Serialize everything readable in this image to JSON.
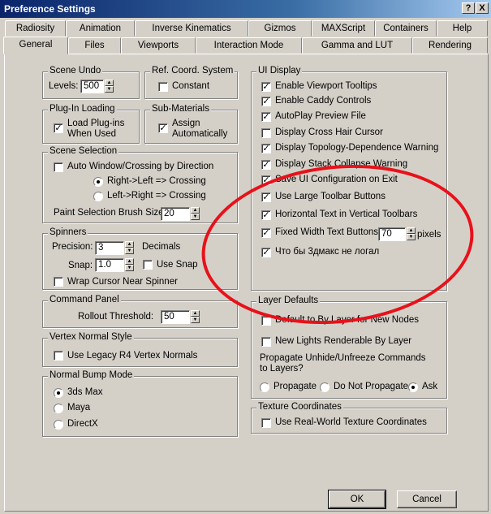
{
  "window": {
    "title": "Preference Settings",
    "help_btn": "?",
    "close_btn": "X"
  },
  "tabs_row1": [
    "Radiosity",
    "Animation",
    "Inverse Kinematics",
    "Gizmos",
    "MAXScript",
    "Containers",
    "Help"
  ],
  "tabs_row2": [
    "General",
    "Files",
    "Viewports",
    "Interaction Mode",
    "Gamma and LUT",
    "Rendering"
  ],
  "scene_undo": {
    "title": "Scene Undo",
    "levels_label": "Levels:",
    "levels_value": "500"
  },
  "ref_coord": {
    "title": "Ref. Coord. System",
    "constant_label": "Constant"
  },
  "plugin_loading": {
    "title": "Plug-In Loading",
    "load_label_1": "Load Plug-ins",
    "load_label_2": "When Used"
  },
  "sub_materials": {
    "title": "Sub-Materials",
    "assign_label_1": "Assign",
    "assign_label_2": "Automatically"
  },
  "scene_selection": {
    "title": "Scene Selection",
    "auto_window": "Auto Window/Crossing by Direction",
    "right_left": "Right->Left => Crossing",
    "left_right": "Left->Right => Crossing",
    "brush_label": "Paint Selection Brush Size",
    "brush_value": "20"
  },
  "spinners": {
    "title": "Spinners",
    "precision_label": "Precision:",
    "precision_value": "3",
    "decimals_label": "Decimals",
    "snap_label": "Snap:",
    "snap_value": "1.0",
    "use_snap_label": "Use Snap",
    "wrap_label": "Wrap Cursor Near Spinner"
  },
  "command_panel": {
    "title": "Command Panel",
    "rollout_label": "Rollout Threshold:",
    "rollout_value": "50"
  },
  "vertex_normal": {
    "title": "Vertex Normal Style",
    "legacy_label": "Use Legacy R4 Vertex Normals"
  },
  "normal_bump": {
    "title": "Normal Bump Mode",
    "opt1": "3ds Max",
    "opt2": "Maya",
    "opt3": "DirectX"
  },
  "ui_display": {
    "title": "UI Display",
    "items": [
      "Enable Viewport Tooltips",
      "Enable Caddy Controls",
      "AutoPlay Preview File",
      "Display Cross Hair Cursor",
      "Display Topology-Dependence Warning",
      "Display Stack Collapse Warning",
      "Save UI Configuration on Exit",
      "Use Large Toolbar Buttons",
      "Horizontal Text in Vertical Toolbars"
    ],
    "fixed_width_label": "Fixed Width Text Buttons:",
    "fixed_width_value": "70",
    "pixels_label": "pixels",
    "custom_label": "Что бы 3дмакс не логал"
  },
  "layer_defaults": {
    "title": "Layer Defaults",
    "default_bylayer": "Default to By Layer for New Nodes",
    "new_lights": "New Lights Renderable By Layer",
    "propagate_q1": "Propagate Unhide/Unfreeze Commands",
    "propagate_q2": "to Layers?",
    "opt_propagate": "Propagate",
    "opt_not": "Do Not Propagate",
    "opt_ask": "Ask"
  },
  "texture_coords": {
    "title": "Texture Coordinates",
    "real_world": "Use Real-World Texture Coordinates"
  },
  "buttons": {
    "ok": "OK",
    "cancel": "Cancel"
  },
  "annotation_color": "#e8111a"
}
